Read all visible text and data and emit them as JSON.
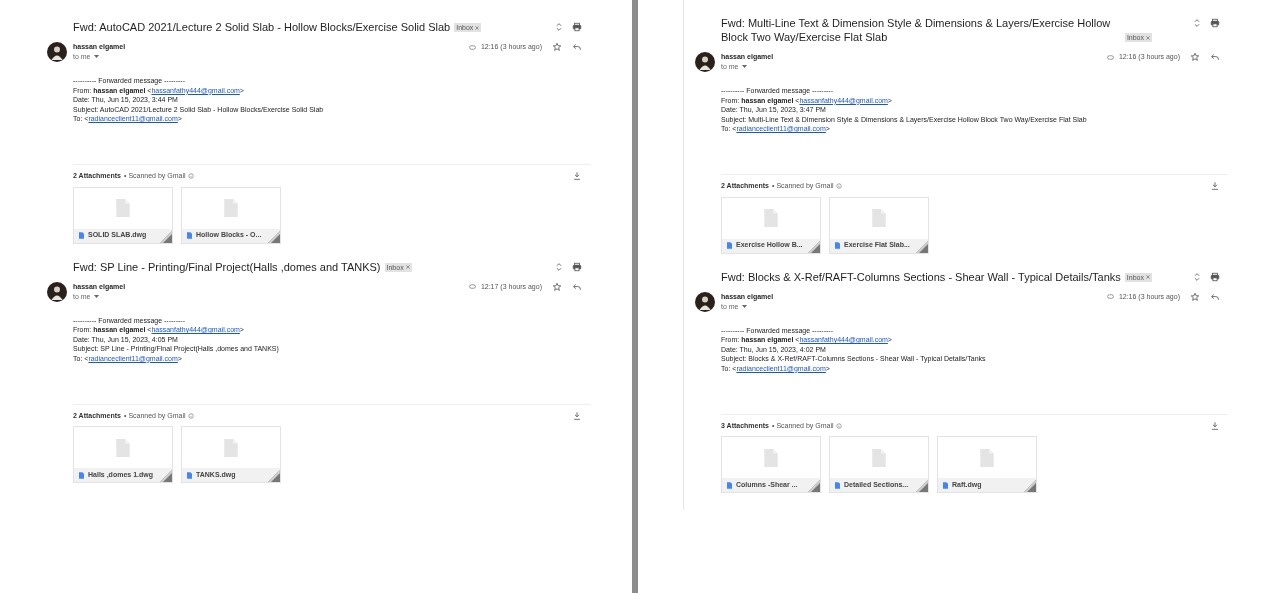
{
  "panels": [
    {
      "emails": [
        {
          "subject": "Fwd: AutoCAD 2021/Lecture 2 Solid Slab - Hollow Blocks/Exercise Solid Slab",
          "label": "Inbox",
          "sender": "hassan elgamel",
          "recipient": "to me",
          "time": "12:16 (3 hours ago)",
          "body": {
            "header": "---------- Forwarded message ---------",
            "from": [
              "From: **hassan elgamel** <",
              "hassanfathy444@gmail.com",
              ">"
            ],
            "date": "Date: Thu, Jun 15, 2023, 3:44 PM",
            "subject": "Subject: AutoCAD 2021/Lecture 2 Solid Slab - Hollow Blocks/Exercise Solid Slab",
            "to": [
              "To: <",
              "radianceclient11@gmail.com",
              ">"
            ]
          },
          "attachments_count": "2 Attachments",
          "scanned": "• Scanned by Gmail",
          "attachments": [
            "SOLID SLAB.dwg",
            "Hollow Blocks - O..."
          ]
        },
        {
          "subject": "Fwd: SP Line - Printing/Final Project(Halls ,domes and TANKS)",
          "label": "Inbox",
          "sender": "hassan elgamel",
          "recipient": "to me",
          "time": "12:17 (3 hours ago)",
          "body": {
            "header": "---------- Forwarded message ---------",
            "from": [
              "From: **hassan elgamel** <",
              "hassanfathy444@gmail.com",
              ">"
            ],
            "date": "Date: Thu, Jun 15, 2023, 4:05 PM",
            "subject": "Subject: SP Line - Printing/Final Project(Halls ,domes and TANKS)",
            "to": [
              "To: <",
              "radianceclient11@gmail.com",
              ">"
            ]
          },
          "attachments_count": "2 Attachments",
          "scanned": "• Scanned by Gmail",
          "attachments": [
            "Halls ,domes 1.dwg",
            "TANKS.dwg"
          ]
        }
      ]
    },
    {
      "emails": [
        {
          "subject": "Fwd: Multi-Line Text & Dimension Style & Dimensions & Layers/Exercise Hollow Block Two Way/Exercise Flat Slab",
          "label": "Inbox",
          "sender": "hassan elgamel",
          "recipient": "to me",
          "time": "12:16 (3 hours ago)",
          "body": {
            "header": "---------- Forwarded message ---------",
            "from": [
              "From: **hassan elgamel** <",
              "hassanfathy444@gmail.com",
              ">"
            ],
            "date": "Date: Thu, Jun 15, 2023, 3:47 PM",
            "subject": "Subject: Multi-Line Text & Dimension Style & Dimensions & Layers/Exercise Hollow Block Two Way/Exercise Flat Slab",
            "to": [
              "To: <",
              "radianceclient11@gmail.com",
              ">"
            ]
          },
          "attachments_count": "2 Attachments",
          "scanned": "• Scanned by Gmail",
          "attachments": [
            "Exercise Hollow B...",
            "Exercise Flat Slab..."
          ]
        },
        {
          "subject": "Fwd: Blocks & X-Ref/RAFT-Columns Sections - Shear Wall - Typical Details/Tanks",
          "label": "Inbox",
          "sender": "hassan elgamel",
          "recipient": "to me",
          "time": "12:16 (3 hours ago)",
          "body": {
            "header": "---------- Forwarded message ---------",
            "from": [
              "From: **hassan elgamel** <",
              "hassanfathy444@gmail.com",
              ">"
            ],
            "date": "Date: Thu, Jun 15, 2023, 4:02 PM",
            "subject": "Subject: Blocks & X-Ref/RAFT-Columns Sections - Shear Wall - Typical Details/Tanks",
            "to": [
              "To: <",
              "radianceclient11@gmail.com",
              ">"
            ]
          },
          "attachments_count": "3 Attachments",
          "scanned": "• Scanned by Gmail",
          "attachments": [
            "Columns -Shear ...",
            "Detailed Sections...",
            "Raft.dwg"
          ]
        }
      ]
    }
  ]
}
